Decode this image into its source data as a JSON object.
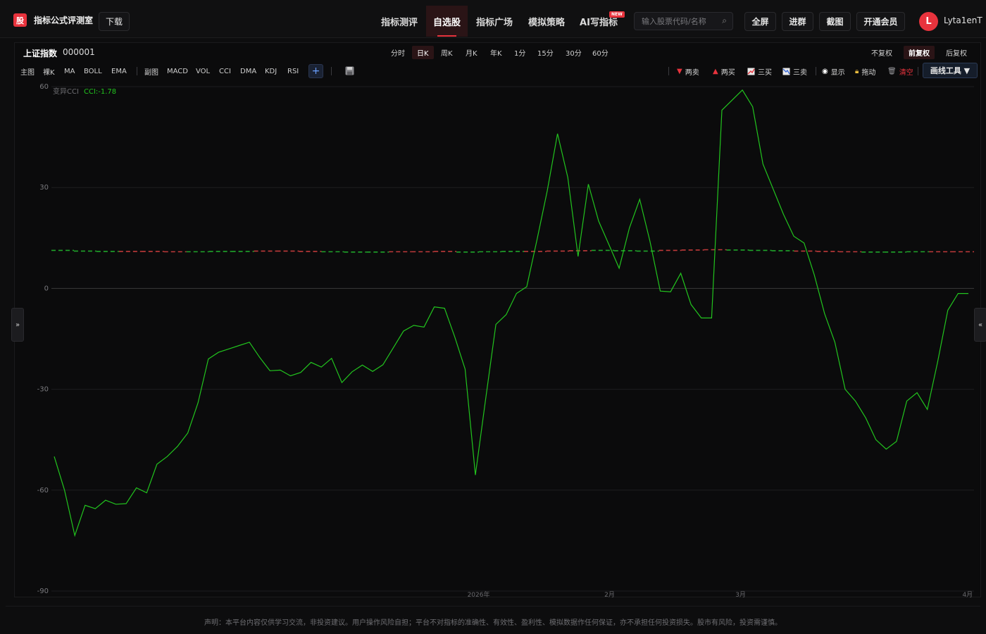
{
  "header": {
    "logo_char": "股",
    "app_name": "指标公式评测室",
    "download_label": "下载",
    "nav": [
      {
        "label": "指标测评",
        "active": false
      },
      {
        "label": "自选股",
        "active": true
      },
      {
        "label": "指标广场",
        "active": false
      },
      {
        "label": "模拟策略",
        "active": false
      },
      {
        "label": "AI写指标",
        "active": false
      }
    ],
    "new_badge": "NEW",
    "search": {
      "placeholder": "输入股票代码/名称",
      "icon": "search-icon"
    },
    "buttons": {
      "fullscreen": "全屏",
      "join_group": "进群",
      "screenshot": "截图",
      "membership": "开通会员"
    },
    "user": {
      "avatar_letter": "L",
      "name": "Lyta1enT"
    }
  },
  "stock": {
    "name": "上证指数",
    "code": "000001"
  },
  "periods": [
    {
      "label": "分时",
      "active": false
    },
    {
      "label": "日K",
      "active": true
    },
    {
      "label": "周K",
      "active": false
    },
    {
      "label": "月K",
      "active": false
    },
    {
      "label": "年K",
      "active": false
    },
    {
      "label": "1分",
      "active": false
    },
    {
      "label": "15分",
      "active": false
    },
    {
      "label": "30分",
      "active": false
    },
    {
      "label": "60分",
      "active": false
    }
  ],
  "adjust": [
    {
      "label": "不复权",
      "active": false
    },
    {
      "label": "前复权",
      "active": true
    },
    {
      "label": "后复权",
      "active": false
    }
  ],
  "indicators": {
    "main": "主图",
    "bare_k": "裸K",
    "ma": "MA",
    "boll": "BOLL",
    "ema": "EMA",
    "sub": "副图",
    "macd": "MACD",
    "vol": "VOL",
    "cci": "CCI",
    "dma": "DMA",
    "kdj": "KDJ",
    "rsi": "RSI",
    "add": "+"
  },
  "tools": {
    "two_sell": "两卖",
    "two_buy": "两买",
    "three_buy": "三买",
    "three_sell": "三卖",
    "show": "显示",
    "drag": "拖动",
    "clear": "清空",
    "draw_tools": "画线工具 ▼"
  },
  "colors": {
    "accent": "#e8333d",
    "cci_line": "#22c41e",
    "ma_green": "#1fa52a",
    "ma_red": "#c03a3a",
    "zero_line": "#3a3a3a",
    "grid": "#1e1e20"
  },
  "chart_data": {
    "type": "line",
    "title": "变异CCI",
    "legend": "CCI:-1.78",
    "ylim": [
      -90,
      60
    ],
    "y_ticks": [
      60,
      30,
      0,
      -30,
      -60,
      -90
    ],
    "x_tick_labels": [
      "2026年",
      "2月",
      "3月",
      "4月"
    ],
    "grid": true,
    "series": [
      {
        "name": "CCI",
        "values": [
          -50,
          -60,
          -73.5,
          -64.5,
          -65.5,
          -63,
          -64.2,
          -64,
          -59.3,
          -60.8,
          -52.3,
          -50,
          -47,
          -43,
          -34,
          -21,
          -19,
          -18,
          -17,
          -16,
          -20.5,
          -24.5,
          -24.3,
          -26,
          -25,
          -22,
          -23.4,
          -20.8,
          -28,
          -24.8,
          -22.8,
          -24.7,
          -22.7,
          -17.7,
          -12.7,
          -11,
          -11.5,
          -5.5,
          -5.9,
          -14.5,
          -24,
          -55.5,
          -33,
          -10.7,
          -7.8,
          -1.5,
          0.5,
          14.5,
          29,
          46,
          33,
          9.5,
          31,
          20,
          13,
          6,
          18,
          26.5,
          14,
          -0.8,
          -1,
          4.5,
          -4.8,
          -8.8,
          -8.8,
          53,
          56,
          59,
          54,
          37,
          29.5,
          22,
          15.5,
          13.5,
          4,
          -7.5,
          -16,
          -30,
          -33.5,
          -38.5,
          -45,
          -47.8,
          -45.5,
          -33.5,
          -31,
          -36,
          -22,
          -6.5,
          -1.5,
          -1.5
        ]
      }
    ],
    "reference_lines": {
      "upper_dashed_level": 11.5,
      "levels_alternate_green_red": [
        11.3,
        11.1,
        11.0,
        11.0,
        11.0,
        10.9,
        10.9,
        11.0,
        11.0,
        11.1,
        11.1,
        11.0,
        10.9,
        10.8,
        10.8,
        10.9,
        10.9,
        11.0,
        10.8,
        10.9,
        11.0,
        11.0,
        11.1,
        11.2,
        11.3,
        11.2,
        11.1,
        11.3,
        11.4,
        11.5,
        11.4,
        11.3,
        11.2,
        11.1,
        11.0,
        10.9,
        10.8,
        10.8,
        10.9,
        10.9,
        10.9
      ]
    }
  },
  "footer": {
    "disclaimer": "声明：本平台内容仅供学习交流，非投资建议。用户操作风险自担；平台不对指标的准确性、有效性、盈利性、模拟数据作任何保证，亦不承担任何投资损失。股市有风险，投资需谨慎。"
  },
  "side_tabs": {
    "left": "»",
    "right": "«"
  }
}
